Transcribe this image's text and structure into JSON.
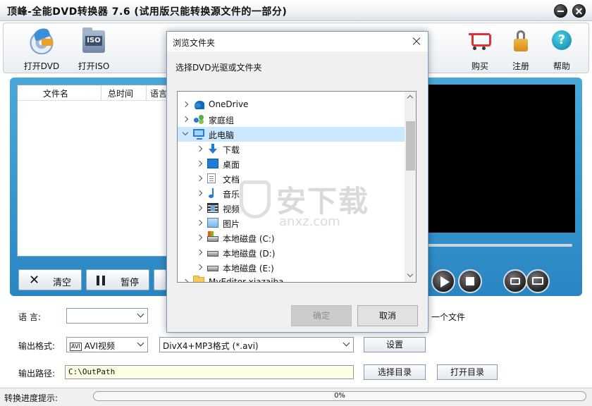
{
  "window": {
    "title": "顶峰-全能DVD转换器 7.6 (试用版只能转换源文件的一部分)"
  },
  "toolbar": {
    "open_dvd": "打开DVD",
    "open_iso": "打开ISO",
    "iso_badge": "ISO",
    "buy": "购买",
    "register": "注册",
    "help": "帮助"
  },
  "file_list": {
    "columns": [
      "文件名",
      "总时间",
      "语言"
    ]
  },
  "actions": {
    "clear": "清空",
    "pause": "暂停"
  },
  "settings": {
    "language_label": "语    言:",
    "language_value": "",
    "output_format_label": "输出格式:",
    "output_format_value": "AVI视频",
    "output_format_tag": "AVI",
    "codec_value": "DivX4+MP3格式 (*.avi)",
    "settings_button": "设置",
    "output_path_label": "输出路径:",
    "output_path_value": "C:\\OutPath",
    "choose_dir_button": "选择目录",
    "open_dir_button": "打开目录",
    "partial_text": "一个文件"
  },
  "status": {
    "progress_label": "转换进度提示:",
    "progress_text": "0%",
    "progress_fraction": 0
  },
  "dialog": {
    "title": "浏览文件夹",
    "prompt": "选择DVD光驱或文件夹",
    "tree": [
      {
        "label": "OneDrive",
        "icon": "onedrive-icon",
        "level": 0,
        "expanded": false,
        "selected": false
      },
      {
        "label": "家庭组",
        "icon": "homegroup-icon",
        "level": 0,
        "expanded": false,
        "selected": false
      },
      {
        "label": "此电脑",
        "icon": "this-pc-icon",
        "level": 0,
        "expanded": true,
        "selected": true
      },
      {
        "label": "下载",
        "icon": "downloads-icon",
        "level": 1,
        "expanded": false,
        "selected": false
      },
      {
        "label": "桌面",
        "icon": "desktop-icon",
        "level": 1,
        "expanded": false,
        "selected": false
      },
      {
        "label": "文档",
        "icon": "documents-icon",
        "level": 1,
        "expanded": false,
        "selected": false
      },
      {
        "label": "音乐",
        "icon": "music-icon",
        "level": 1,
        "expanded": false,
        "selected": false
      },
      {
        "label": "视频",
        "icon": "videos-icon",
        "level": 1,
        "expanded": false,
        "selected": false
      },
      {
        "label": "图片",
        "icon": "pictures-icon",
        "level": 1,
        "expanded": false,
        "selected": false
      },
      {
        "label": "本地磁盘 (C:)",
        "icon": "drive-c-icon",
        "level": 1,
        "expanded": false,
        "selected": false
      },
      {
        "label": "本地磁盘 (D:)",
        "icon": "drive-icon",
        "level": 1,
        "expanded": false,
        "selected": false
      },
      {
        "label": "本地磁盘 (E:)",
        "icon": "drive-icon",
        "level": 1,
        "expanded": false,
        "selected": false
      },
      {
        "label": "MyEditor xiazaiba",
        "icon": "folder-icon",
        "level": 0,
        "expanded": false,
        "selected": false
      }
    ],
    "ok": "确定",
    "cancel": "取消"
  },
  "watermark": {
    "text": "安下载",
    "subtext": "anxz.com"
  },
  "colors": {
    "accent_blue": "#2a86c2",
    "selection": "#cce8ff",
    "progress": "#3a9bd6"
  }
}
